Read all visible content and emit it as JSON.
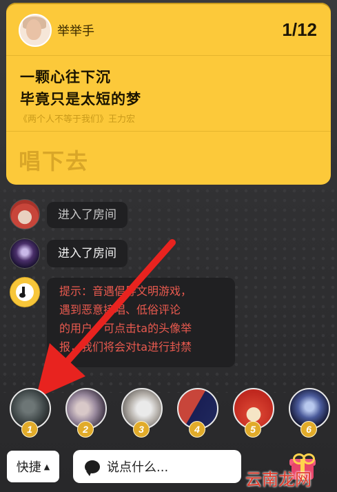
{
  "song_card": {
    "singer_name": "举举手",
    "page_count": "1/12",
    "lyric_line_1": "一颗心往下沉",
    "lyric_line_2": "毕竟只是太短的梦",
    "song_source": "《两个人不等于我们》王力宏",
    "sing_on_label": "唱下去",
    "background_color": "#fcc93a"
  },
  "chat": {
    "messages": [
      {
        "text": "进入了房间"
      },
      {
        "text": "进入了房间"
      },
      {
        "lines": [
          "提示：音遇倡导文明游戏，",
          "遇到恶意接唱、低俗评论",
          "的用户，可点击ta的头像举",
          "报，我们将会对ta进行封禁"
        ],
        "color": "#ea5a4f"
      }
    ]
  },
  "seats": [
    {
      "number": "1"
    },
    {
      "number": "2"
    },
    {
      "number": "3"
    },
    {
      "number": "4"
    },
    {
      "number": "5"
    },
    {
      "number": "6"
    }
  ],
  "bottom_bar": {
    "quick_label": "快捷",
    "input_placeholder": "说点什么...",
    "gift_icon": "gift-icon"
  },
  "watermark": "云南龙网",
  "annotation": {
    "arrow_color": "#e8231f"
  }
}
